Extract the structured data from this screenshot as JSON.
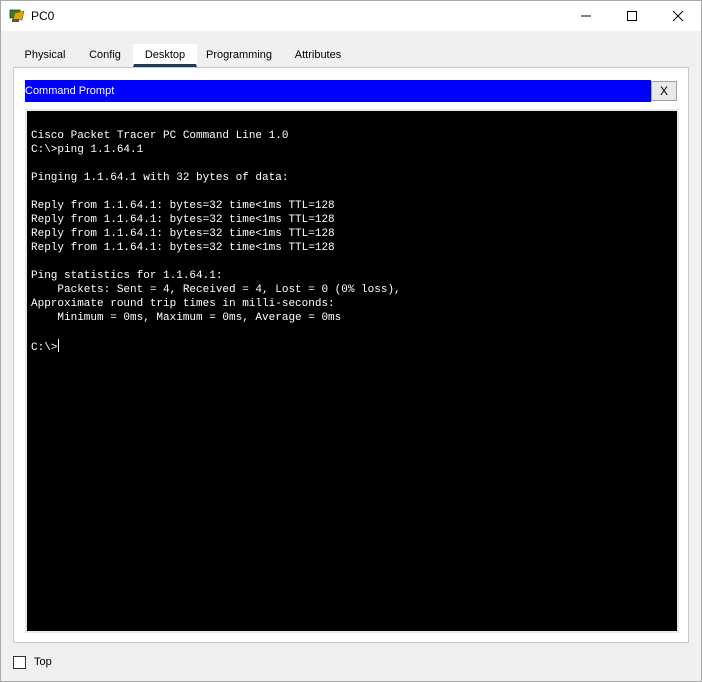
{
  "window": {
    "title": "PC0",
    "icons": {
      "app": "cisco-pc-icon",
      "minimize": "minimize-icon",
      "maximize": "maximize-icon",
      "close": "close-icon"
    }
  },
  "tabs": [
    {
      "label": "Physical"
    },
    {
      "label": "Config"
    },
    {
      "label": "Desktop"
    },
    {
      "label": "Programming"
    },
    {
      "label": "Attributes"
    }
  ],
  "active_tab": "Desktop",
  "command_prompt": {
    "title": "Command Prompt",
    "close_label": "X",
    "lines": [
      "Cisco Packet Tracer PC Command Line 1.0",
      "C:\\>ping 1.1.64.1",
      "",
      "Pinging 1.1.64.1 with 32 bytes of data:",
      "",
      "Reply from 1.1.64.1: bytes=32 time<1ms TTL=128",
      "Reply from 1.1.64.1: bytes=32 time<1ms TTL=128",
      "Reply from 1.1.64.1: bytes=32 time<1ms TTL=128",
      "Reply from 1.1.64.1: bytes=32 time<1ms TTL=128",
      "",
      "Ping statistics for 1.1.64.1:",
      "    Packets: Sent = 4, Received = 4, Lost = 0 (0% loss),",
      "Approximate round trip times in milli-seconds:",
      "    Minimum = 0ms, Maximum = 0ms, Average = 0ms",
      ""
    ],
    "prompt": "C:\\>"
  },
  "footer": {
    "top_label": "Top",
    "top_checked": false
  },
  "colors": {
    "header_blue": "#0000ff",
    "console_bg": "#000000",
    "console_fg": "#ffffff",
    "active_tab_underline": "#1f3b5c"
  }
}
